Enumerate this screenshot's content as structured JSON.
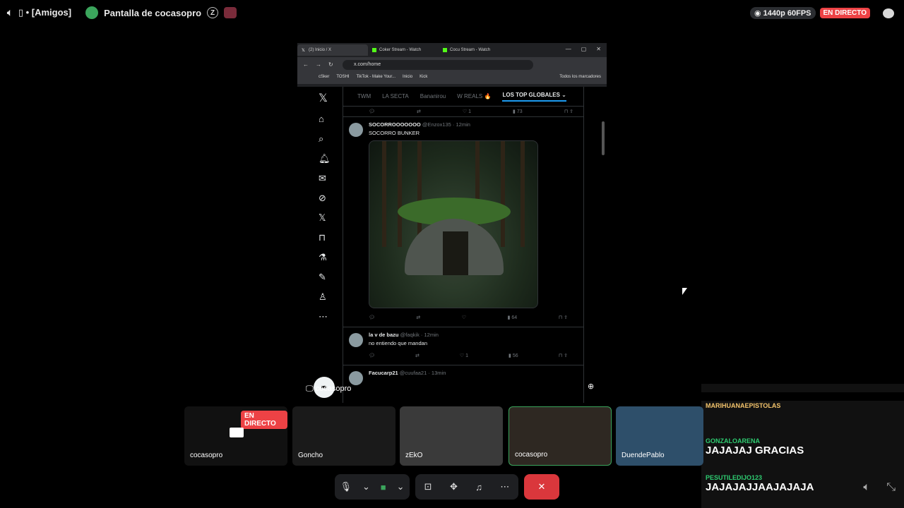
{
  "topbar": {
    "channel_prefix": "[Amigos]",
    "screen_title": "Pantalla de cocasopro",
    "quality": "1440p 60FPS",
    "live": "EN DIRECTO"
  },
  "browser": {
    "tabs": [
      "(2) Inicio / X",
      "Coker Stream - Watch",
      "Cocu Stream - Watch"
    ],
    "url": "x.com/home",
    "bookmarks": [
      "cSker",
      "TOSHI",
      "TikTok - Make Your...",
      "Inicio",
      "Kick",
      "Todos los marcadores"
    ]
  },
  "x": {
    "tabs": [
      "TWM",
      "LA SECTA",
      "Bananirou",
      "W REALS 🔥",
      "LOS TOP GLOBALES"
    ],
    "top_actions": {
      "likes": "1",
      "views": "73"
    },
    "tweets": [
      {
        "name": "SOCORROOOOOOO",
        "handle": "@Enzox135 · 12min",
        "text": "SOCORRO BUNKER",
        "views": "64"
      },
      {
        "name": "la v de bazu",
        "handle": "@faqkik · 12min",
        "text": "no entiendo que mandan",
        "likes": "1",
        "views": "56"
      },
      {
        "name": "Facucarp21",
        "handle": "@cuufaa21 · 13min"
      }
    ]
  },
  "share_label": "cocasopro",
  "chat": [
    {
      "name": "MARIHUANAEPISTOLAS",
      "color": "#f3c36b",
      "msg": ""
    },
    {
      "name": "GONZALOARENA",
      "color": "#2ecc71",
      "msg": "JAJAJAJ GRACIAS"
    },
    {
      "name": "PESUTILEDIJO123",
      "color": "#2ecc71",
      "msg": "JAJAJAJJAAJAJAJA"
    }
  ],
  "participants": [
    {
      "name": "cocasopro",
      "badge": "EN DIRECTO"
    },
    {
      "name": "Goncho"
    },
    {
      "name": "zEkO"
    },
    {
      "name": "cocasopro"
    },
    {
      "name": "DuendePablo"
    }
  ]
}
